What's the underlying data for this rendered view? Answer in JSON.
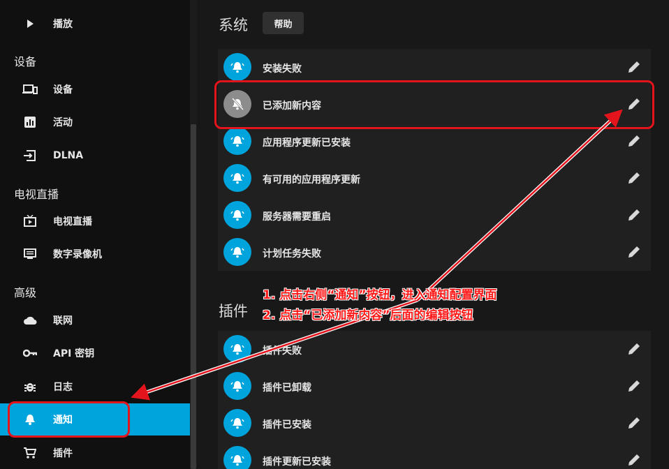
{
  "sidebar": {
    "items": [
      {
        "label": "播放",
        "icon": "play-icon"
      },
      {
        "label": "设备",
        "icon": "devices-icon"
      },
      {
        "label": "活动",
        "icon": "activity-icon"
      },
      {
        "label": "DLNA",
        "icon": "dlna-icon"
      },
      {
        "label": "电视直播",
        "icon": "live-tv-icon"
      },
      {
        "label": "数字录像机",
        "icon": "dvr-icon"
      },
      {
        "label": "联网",
        "icon": "cloud-icon"
      },
      {
        "label": "API 密钥",
        "icon": "key-icon"
      },
      {
        "label": "日志",
        "icon": "bug-icon"
      },
      {
        "label": "通知",
        "icon": "bell-icon",
        "active": true
      },
      {
        "label": "插件",
        "icon": "cart-icon"
      }
    ],
    "sections": {
      "devices": "设备",
      "livetv": "电视直播",
      "advanced": "高级"
    }
  },
  "main": {
    "system_title": "系统",
    "help_label": "帮助",
    "system_rows": [
      {
        "label": "安装失败",
        "enabled": true
      },
      {
        "label": "已添加新内容",
        "enabled": false
      },
      {
        "label": "应用程序更新已安装",
        "enabled": true
      },
      {
        "label": "有可用的应用程序更新",
        "enabled": true
      },
      {
        "label": "服务器需要重启",
        "enabled": true
      },
      {
        "label": "计划任务失败",
        "enabled": true
      }
    ],
    "plugins_title": "插件",
    "plugin_rows": [
      {
        "label": "插件失败",
        "enabled": true
      },
      {
        "label": "插件已卸载",
        "enabled": true
      },
      {
        "label": "插件已安装",
        "enabled": true
      },
      {
        "label": "插件更新已安装",
        "enabled": true
      }
    ]
  },
  "annotation": {
    "line1": "1. 点击右侧“通知”按钮，进入通知配置界面",
    "line2": "2. 点击“已添加新内容”后面的编辑按钮"
  },
  "colors": {
    "accent": "#00a4dc",
    "annotation": "#e3141c",
    "disabled": "#8c8c8c"
  }
}
